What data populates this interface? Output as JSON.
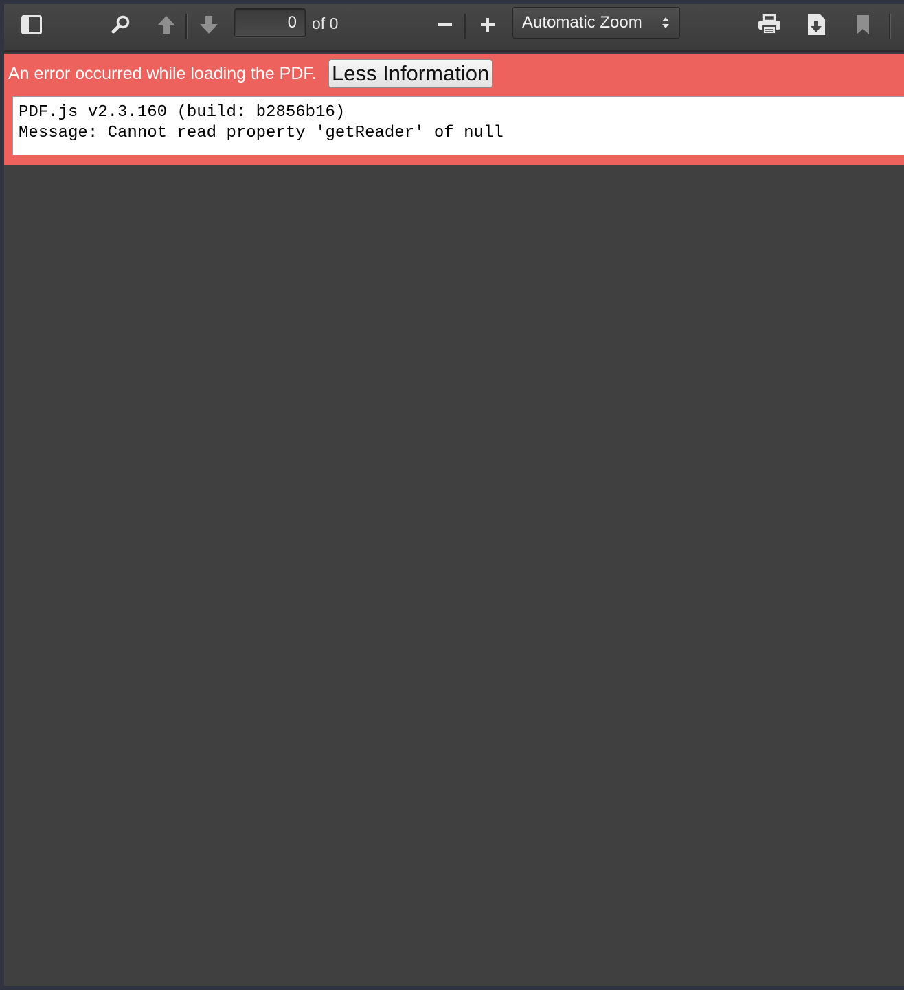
{
  "toolbar": {
    "page_number_value": "0",
    "page_count": "of 0",
    "zoom_selected": "Automatic Zoom"
  },
  "icons": {
    "sidebar_toggle": "sidebar-toggle-icon",
    "find": "search-icon",
    "previous_page": "arrow-up-icon",
    "next_page": "arrow-down-icon",
    "zoom_out": "minus-icon",
    "zoom_in": "plus-icon",
    "zoom_dropdown": "chevron-updown-icon",
    "print": "printer-icon",
    "download": "download-icon",
    "bookmark": "bookmark-icon"
  },
  "error": {
    "message": "An error occurred while loading the PDF.",
    "toggle_label": "Less Information",
    "details_line1": "PDF.js v2.3.160 (build: b2856b16)",
    "details_line2": "Message: Cannot read property 'getReader' of null"
  },
  "colors": {
    "error_background": "#ee625d",
    "toolbar_background": "#474747",
    "viewer_background": "#404040"
  }
}
